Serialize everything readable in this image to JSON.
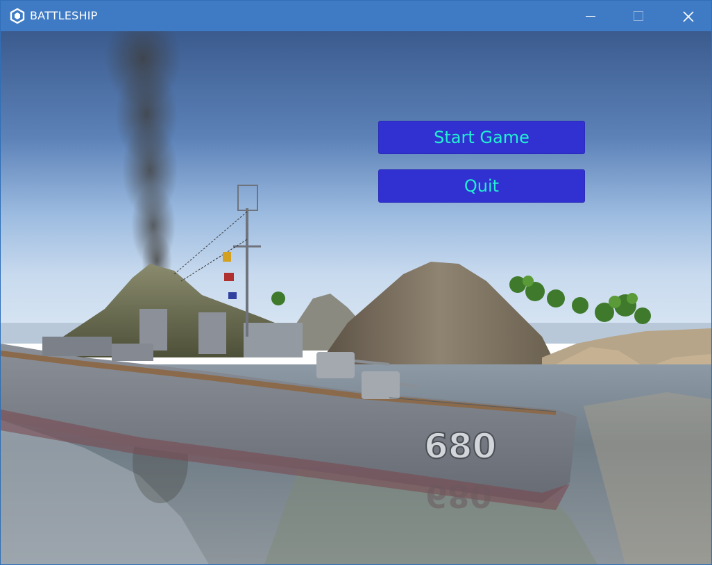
{
  "window": {
    "title": "BATTLESHIP",
    "titlebar_color": "#3f7bc4",
    "app_icon": "unity-logo-icon",
    "controls": [
      "minimize-icon",
      "maximize-icon",
      "close-icon"
    ]
  },
  "menu": {
    "start_label": "Start Game",
    "quit_label": "Quit",
    "button_color": "#3131d2",
    "text_color": "#22f0d0"
  },
  "scene": {
    "hull_number": "680"
  }
}
